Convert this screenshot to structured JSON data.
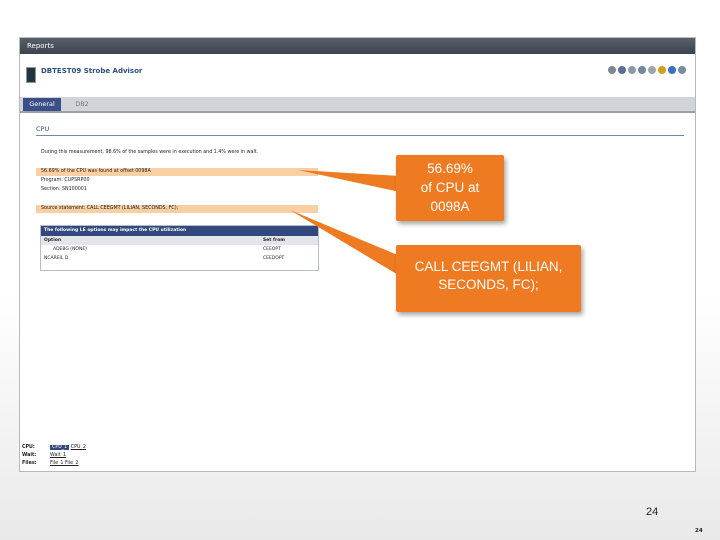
{
  "menubar": {
    "label": "Reports"
  },
  "header": {
    "app_title": "DBTEST09 Strobe Advisor"
  },
  "toolbar": {
    "icons": [
      "printer-icon",
      "folder-icon",
      "refresh-icon",
      "export-icon",
      "settings-icon",
      "star-icon",
      "help-icon",
      "info-icon"
    ]
  },
  "tabs": [
    {
      "label": "General"
    },
    {
      "label": "DB2"
    }
  ],
  "section": {
    "title": "CPU"
  },
  "rows": {
    "intro": "During this measurement, 98.6% of the samples were in execution and 1.4% were in wait.",
    "cpu_offset": "56.69% of the CPU was found at offset 0098A",
    "program": "Program: CUPSRP00",
    "section": "Section: SN100001",
    "source": "Source statement:  CALL CEEGMT (LILIAN, SECONDS, FC);"
  },
  "le_table": {
    "title": "The following LE options may impact the CPU utilization",
    "col_option": "Option",
    "col_setfrom": "Set from",
    "rows": [
      {
        "option": "ADEBG (NONE)",
        "setfrom": "CEEOPT"
      },
      {
        "option": "NCAREIL D",
        "setfrom": "CEEDOPT"
      }
    ]
  },
  "footer": {
    "cpu_label": "CPU:",
    "cpu_sel": "CPU_1",
    "cpu_other": "CPU_2",
    "wait_label": "Wait:",
    "wait_val": "Wait_1",
    "files_label": "Files:",
    "files_val": "File_1 File_2"
  },
  "callouts": {
    "first": [
      "56.69%",
      "of CPU at",
      "0098A"
    ],
    "second": [
      "CALL CEEGMT (LILIAN,",
      "SECONDS, FC);"
    ]
  },
  "slide": {
    "page_number": "24",
    "page_number_small": "24"
  },
  "colors": {
    "callout": "#ee7a22",
    "highlight": "#f9cfa4",
    "tab_active": "#3b4f86"
  }
}
